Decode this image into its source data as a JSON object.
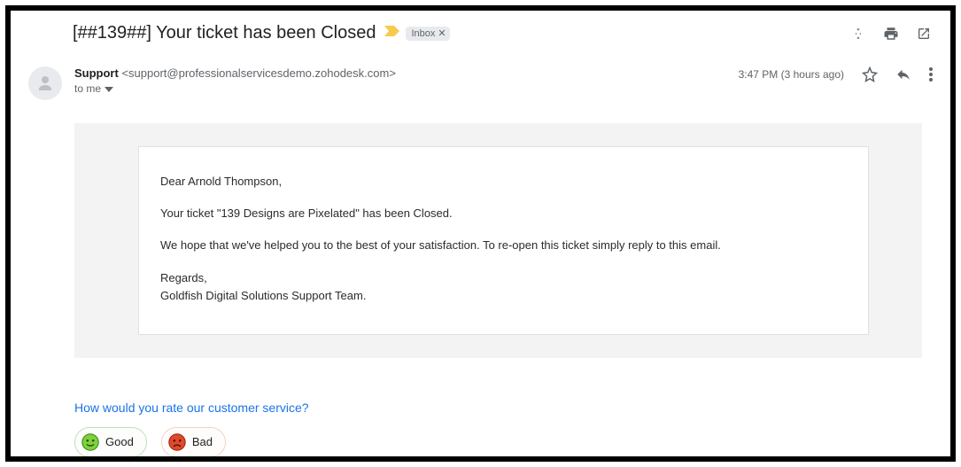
{
  "subject": "[##139##] Your ticket has been Closed",
  "inbox_label": "Inbox",
  "collapse_tooltip": "Collapse",
  "print_tooltip": "Print",
  "newwin_tooltip": "Open in new window",
  "sender": {
    "name": "Support",
    "email": "<support@professionalservicesdemo.zohodesk.com>"
  },
  "recipient_line": "to me",
  "timestamp": "3:47 PM (3 hours ago)",
  "star_tooltip": "Not starred",
  "reply_tooltip": "Reply",
  "more_tooltip": "More",
  "body": {
    "greeting": "Dear Arnold Thompson,",
    "line1": "Your ticket \"139 Designs are Pixelated\" has been Closed.",
    "line2": "We hope that we've helped you to the best of your satisfaction. To re-open this ticket simply reply to this email.",
    "regards": "Regards,",
    "team": "Goldfish Digital Solutions Support Team."
  },
  "rating": {
    "question": "How would you rate our customer service?",
    "good_label": "Good",
    "bad_label": "Bad"
  }
}
